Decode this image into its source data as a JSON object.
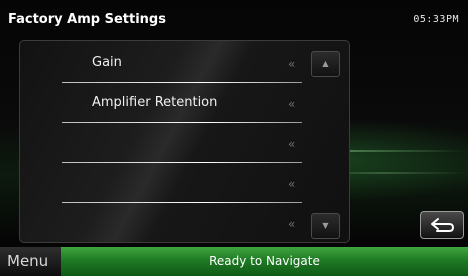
{
  "header": {
    "title": "Factory Amp Settings",
    "clock": "05:33PM"
  },
  "list": {
    "items": [
      {
        "label": "Gain"
      },
      {
        "label": "Amplifier Retention"
      },
      {
        "label": ""
      },
      {
        "label": ""
      },
      {
        "label": ""
      }
    ],
    "item_arrow_glyph": "«"
  },
  "scroll": {
    "up_icon": "triangle-up-icon",
    "down_icon": "triangle-down-icon",
    "up_glyph": "▲",
    "down_glyph": "▼"
  },
  "back_button": {
    "icon": "return-arrow-icon"
  },
  "bottom_bar": {
    "menu_label": "Menu",
    "status_text": "Ready to Navigate"
  },
  "colors": {
    "accent_green": "#2e8f30",
    "background": "#000000"
  }
}
